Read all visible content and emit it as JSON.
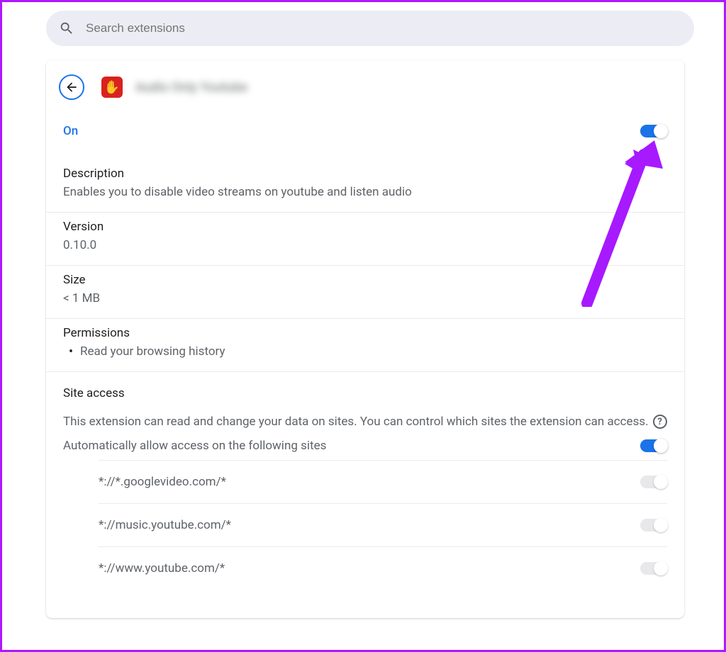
{
  "search": {
    "placeholder": "Search extensions"
  },
  "extension": {
    "name": "Audio Only Youtube",
    "on_label": "On",
    "description_label": "Description",
    "description_value": "Enables you to disable video streams on youtube and listen audio",
    "version_label": "Version",
    "version_value": "0.10.0",
    "size_label": "Size",
    "size_value": "< 1 MB",
    "permissions_label": "Permissions",
    "permissions": [
      "Read your browsing history"
    ],
    "site_access": {
      "title": "Site access",
      "description": "This extension can read and change your data on sites. You can control which sites the extension can access.",
      "auto_allow_label": "Automatically allow access on the following sites",
      "sites": [
        "*://*.googlevideo.com/*",
        "*://music.youtube.com/*",
        "*://www.youtube.com/*"
      ]
    }
  },
  "toggles": {
    "main": true,
    "auto_allow": true,
    "site_0": false,
    "site_1": false,
    "site_2": false
  },
  "colors": {
    "accent": "#1a73e8",
    "border": "#af18ff",
    "arrow": "#a719ff"
  }
}
